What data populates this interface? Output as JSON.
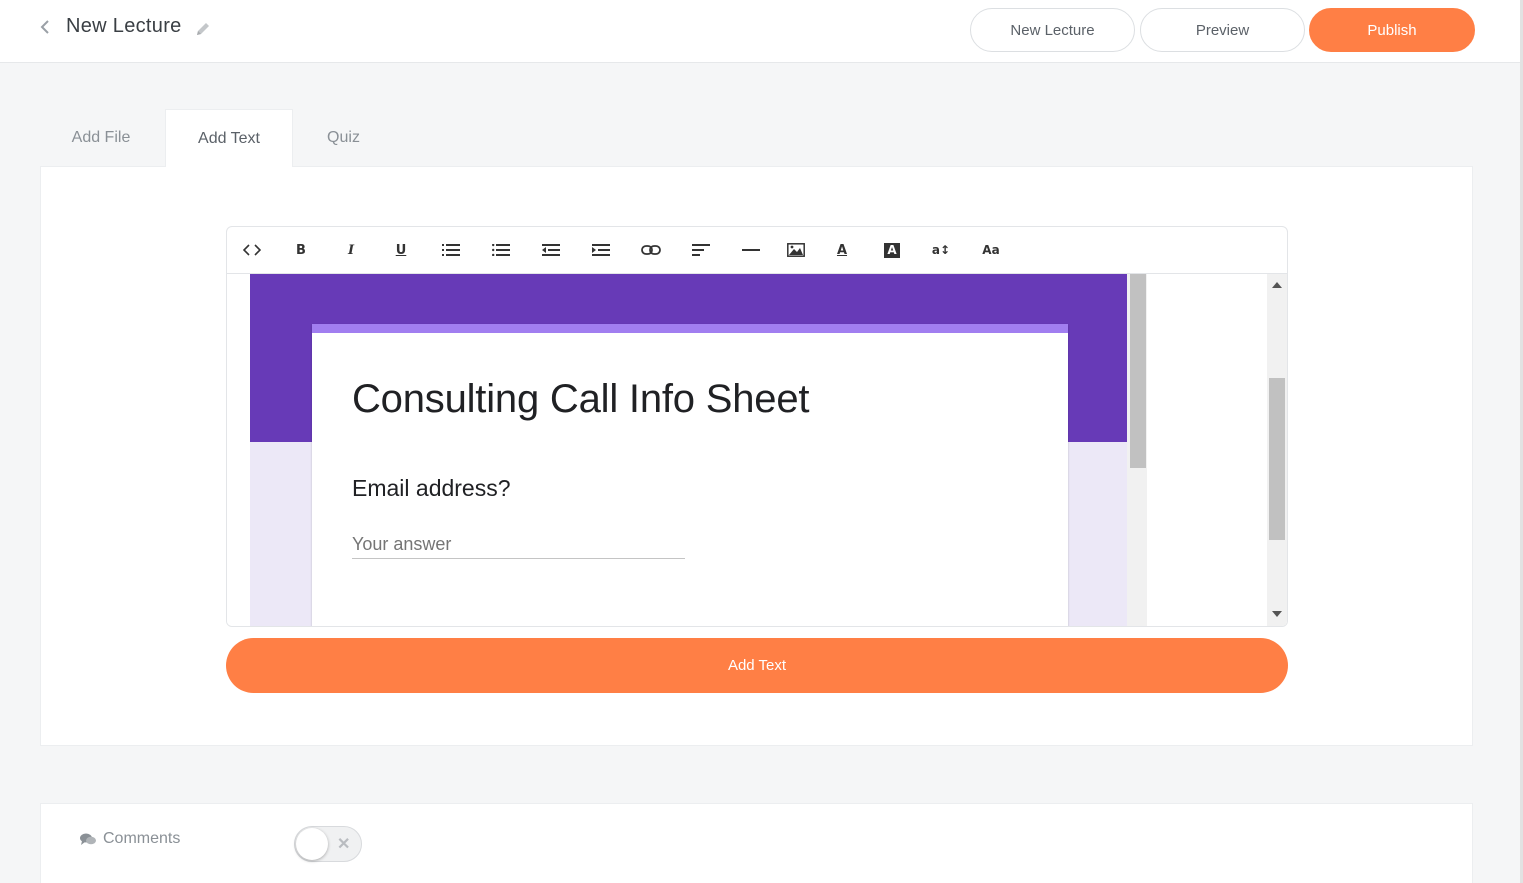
{
  "header": {
    "title": "New Lecture",
    "buttons": {
      "new_lecture": "New Lecture",
      "preview": "Preview",
      "publish": "Publish"
    }
  },
  "tabs": [
    {
      "label": "Add File",
      "active": false
    },
    {
      "label": "Add Text",
      "active": true
    },
    {
      "label": "Quiz",
      "active": false
    }
  ],
  "toolbar": {
    "bold": "B",
    "italic": "I",
    "underline": "U",
    "text_color": "A",
    "background_color": "A",
    "line_height": "a↕",
    "font_size": "Aa"
  },
  "embedded_form": {
    "title": "Consulting Call Info Sheet",
    "question": "Email address?",
    "answer_placeholder": "Your answer"
  },
  "add_text_button": "Add Text",
  "comments": {
    "label": "Comments",
    "enabled": false
  },
  "colors": {
    "accent": "#ff7f45",
    "form_header": "#673ab7",
    "form_accent_bar": "#a17ef0",
    "form_background": "#ece8f7"
  }
}
